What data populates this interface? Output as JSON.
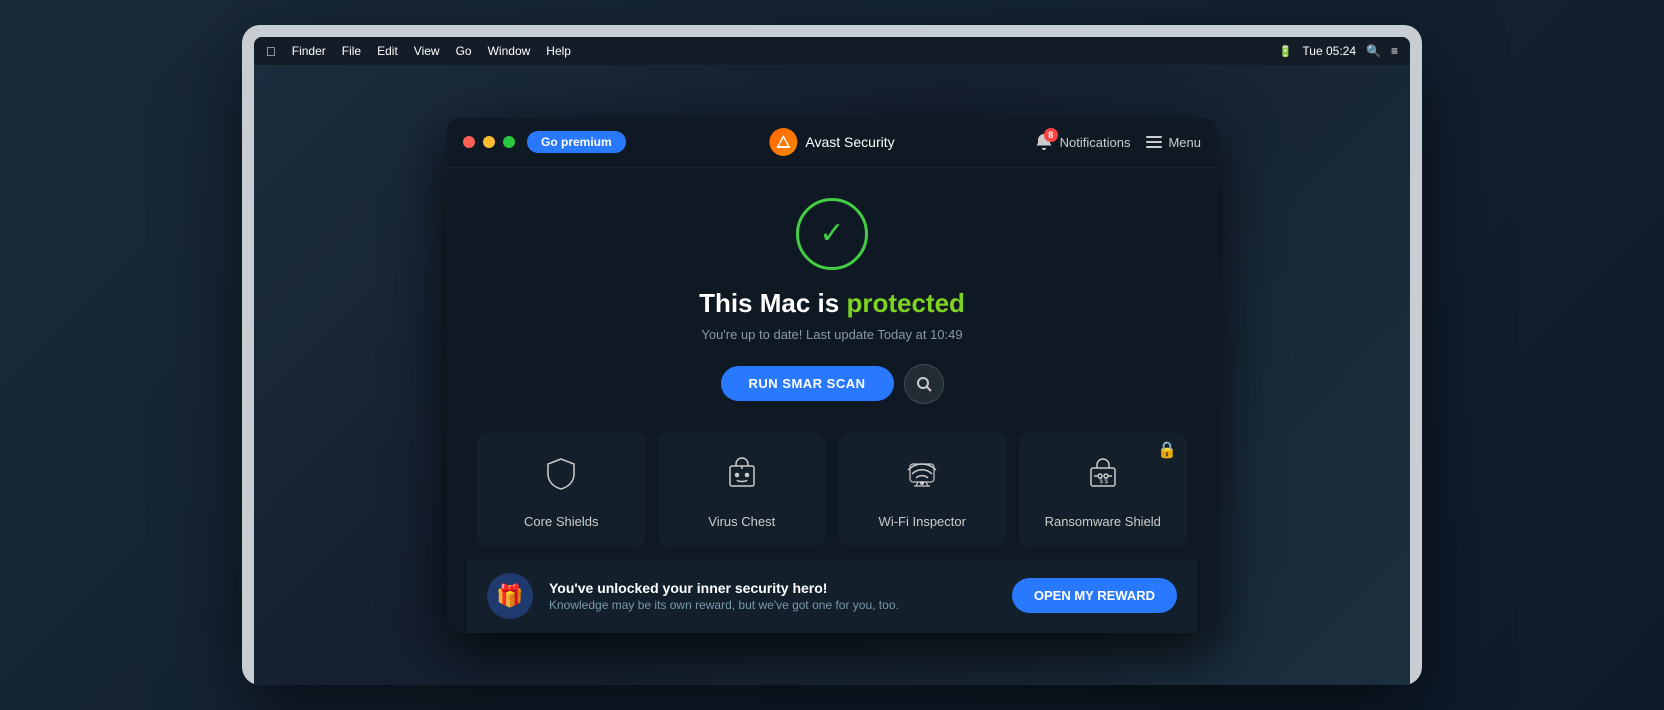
{
  "menubar": {
    "finder": "Finder",
    "file": "File",
    "edit": "Edit",
    "view": "View",
    "go": "Go",
    "window": "Window",
    "help": "Help",
    "time": "Tue 05:24"
  },
  "window": {
    "title": "Avast Security",
    "premium_btn": "Go premium",
    "notifications_label": "Notifications",
    "notifications_count": "8",
    "menu_label": "Menu"
  },
  "status": {
    "title_static": "This Mac is ",
    "title_dynamic": "protected",
    "subtitle": "You're up to date! Last update Today at 10:49"
  },
  "buttons": {
    "run_scan": "RUN SMAR SCAN",
    "open_reward": "OPEN MY REWARD"
  },
  "cards": [
    {
      "id": "core-shields",
      "label": "Core Shields",
      "locked": false
    },
    {
      "id": "virus-chest",
      "label": "Virus Chest",
      "locked": false
    },
    {
      "id": "wifi-inspector",
      "label": "Wi-Fi Inspector",
      "locked": false
    },
    {
      "id": "ransomware-shield",
      "label": "Ransomware Shield",
      "locked": true
    }
  ],
  "reward": {
    "title": "You've unlocked your inner security hero!",
    "subtitle": "Knowledge may be its own reward, but we've got one for you, too."
  }
}
